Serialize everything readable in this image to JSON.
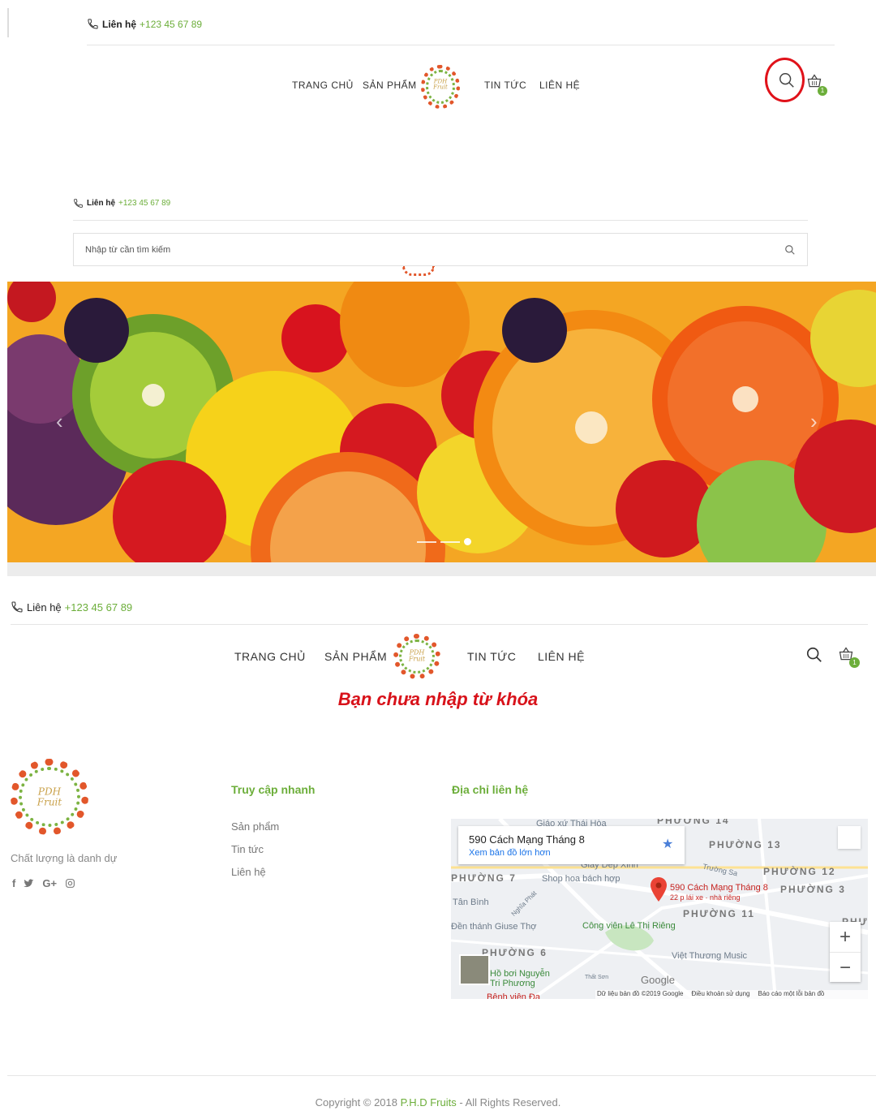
{
  "header1": {
    "contact_label": "Liên hệ",
    "contact_phone": "+123 45 67 89",
    "nav": [
      "TRANG CHỦ",
      "SẢN PHẨM",
      "TIN TỨC",
      "LIÊN HỆ"
    ],
    "logo_text": [
      "PDH",
      "Fruit"
    ],
    "cart_count": "1"
  },
  "search_overlay": {
    "contact_label": "Liên hệ",
    "contact_phone": "+123 45 67 89",
    "placeholder": "Nhập từ cần tìm kiếm"
  },
  "hero": {
    "slide_count": 3,
    "active_slide": 3
  },
  "header2": {
    "contact_label": "Liên hệ",
    "contact_phone": "+123 45 67 89",
    "nav": [
      "TRANG CHỦ",
      "SẢN PHẨM",
      "TIN TỨC",
      "LIÊN HỆ"
    ],
    "logo_text": [
      "PDH",
      "Fruit"
    ],
    "cart_count": "1"
  },
  "message": "Bạn chưa nhập từ khóa",
  "footer": {
    "logo_text": [
      "PDH",
      "Fruit"
    ],
    "slogan": "Chất lượng là danh dự",
    "social_icons": [
      "facebook-icon",
      "twitter-icon",
      "google-plus-icon",
      "instagram-icon"
    ],
    "quick_access_title": "Truy cập nhanh",
    "quick_links": [
      "Sản phẩm",
      "Tin tức",
      "Liên hệ"
    ],
    "address_title": "Địa chỉ liên hệ",
    "map": {
      "place_title": "590 Cách Mạng Tháng 8",
      "view_larger": "Xem bản đồ lớn hơn",
      "pin_label": "590 Cách Mạng Tháng 8",
      "pin_sub": "22 p lái xe · nhà riêng",
      "labels": [
        "Giáo xứ Thái Hòa",
        "Giày Dép Xinh",
        "Shop hoa bách hợp",
        "Trường Sa",
        "Tân Bình",
        "Nghĩa Phát",
        "Đền thánh Giuse Thợ",
        "Công viên Lê Thị Riêng",
        "Việt Thương Music",
        "Hồ bơi Nguyễn Tri Phương",
        "Thất Sơn",
        "Bệnh viện Đa"
      ],
      "wards": [
        "PHƯỜNG 14",
        "PHƯỜNG 13",
        "PHƯỜNG 12",
        "PHƯỜNG 7",
        "PHƯỜNG 3",
        "PHƯỜNG 11",
        "PHƯỜNG 6",
        "PHƯ"
      ],
      "attribution": "Dữ liệu bản đồ ©2019 Google",
      "terms": "Điều khoản sử dụng",
      "report": "Báo cáo một lỗi bản đồ",
      "google": "Google"
    }
  },
  "copyright": {
    "prefix": "Copyright © 2018 ",
    "brand": "P.H.D Fruits",
    "suffix": " - All Rights Reserved."
  },
  "colors": {
    "accent": "#6cae3a",
    "highlight_circle": "#e0121a",
    "message": "#d8121a"
  }
}
